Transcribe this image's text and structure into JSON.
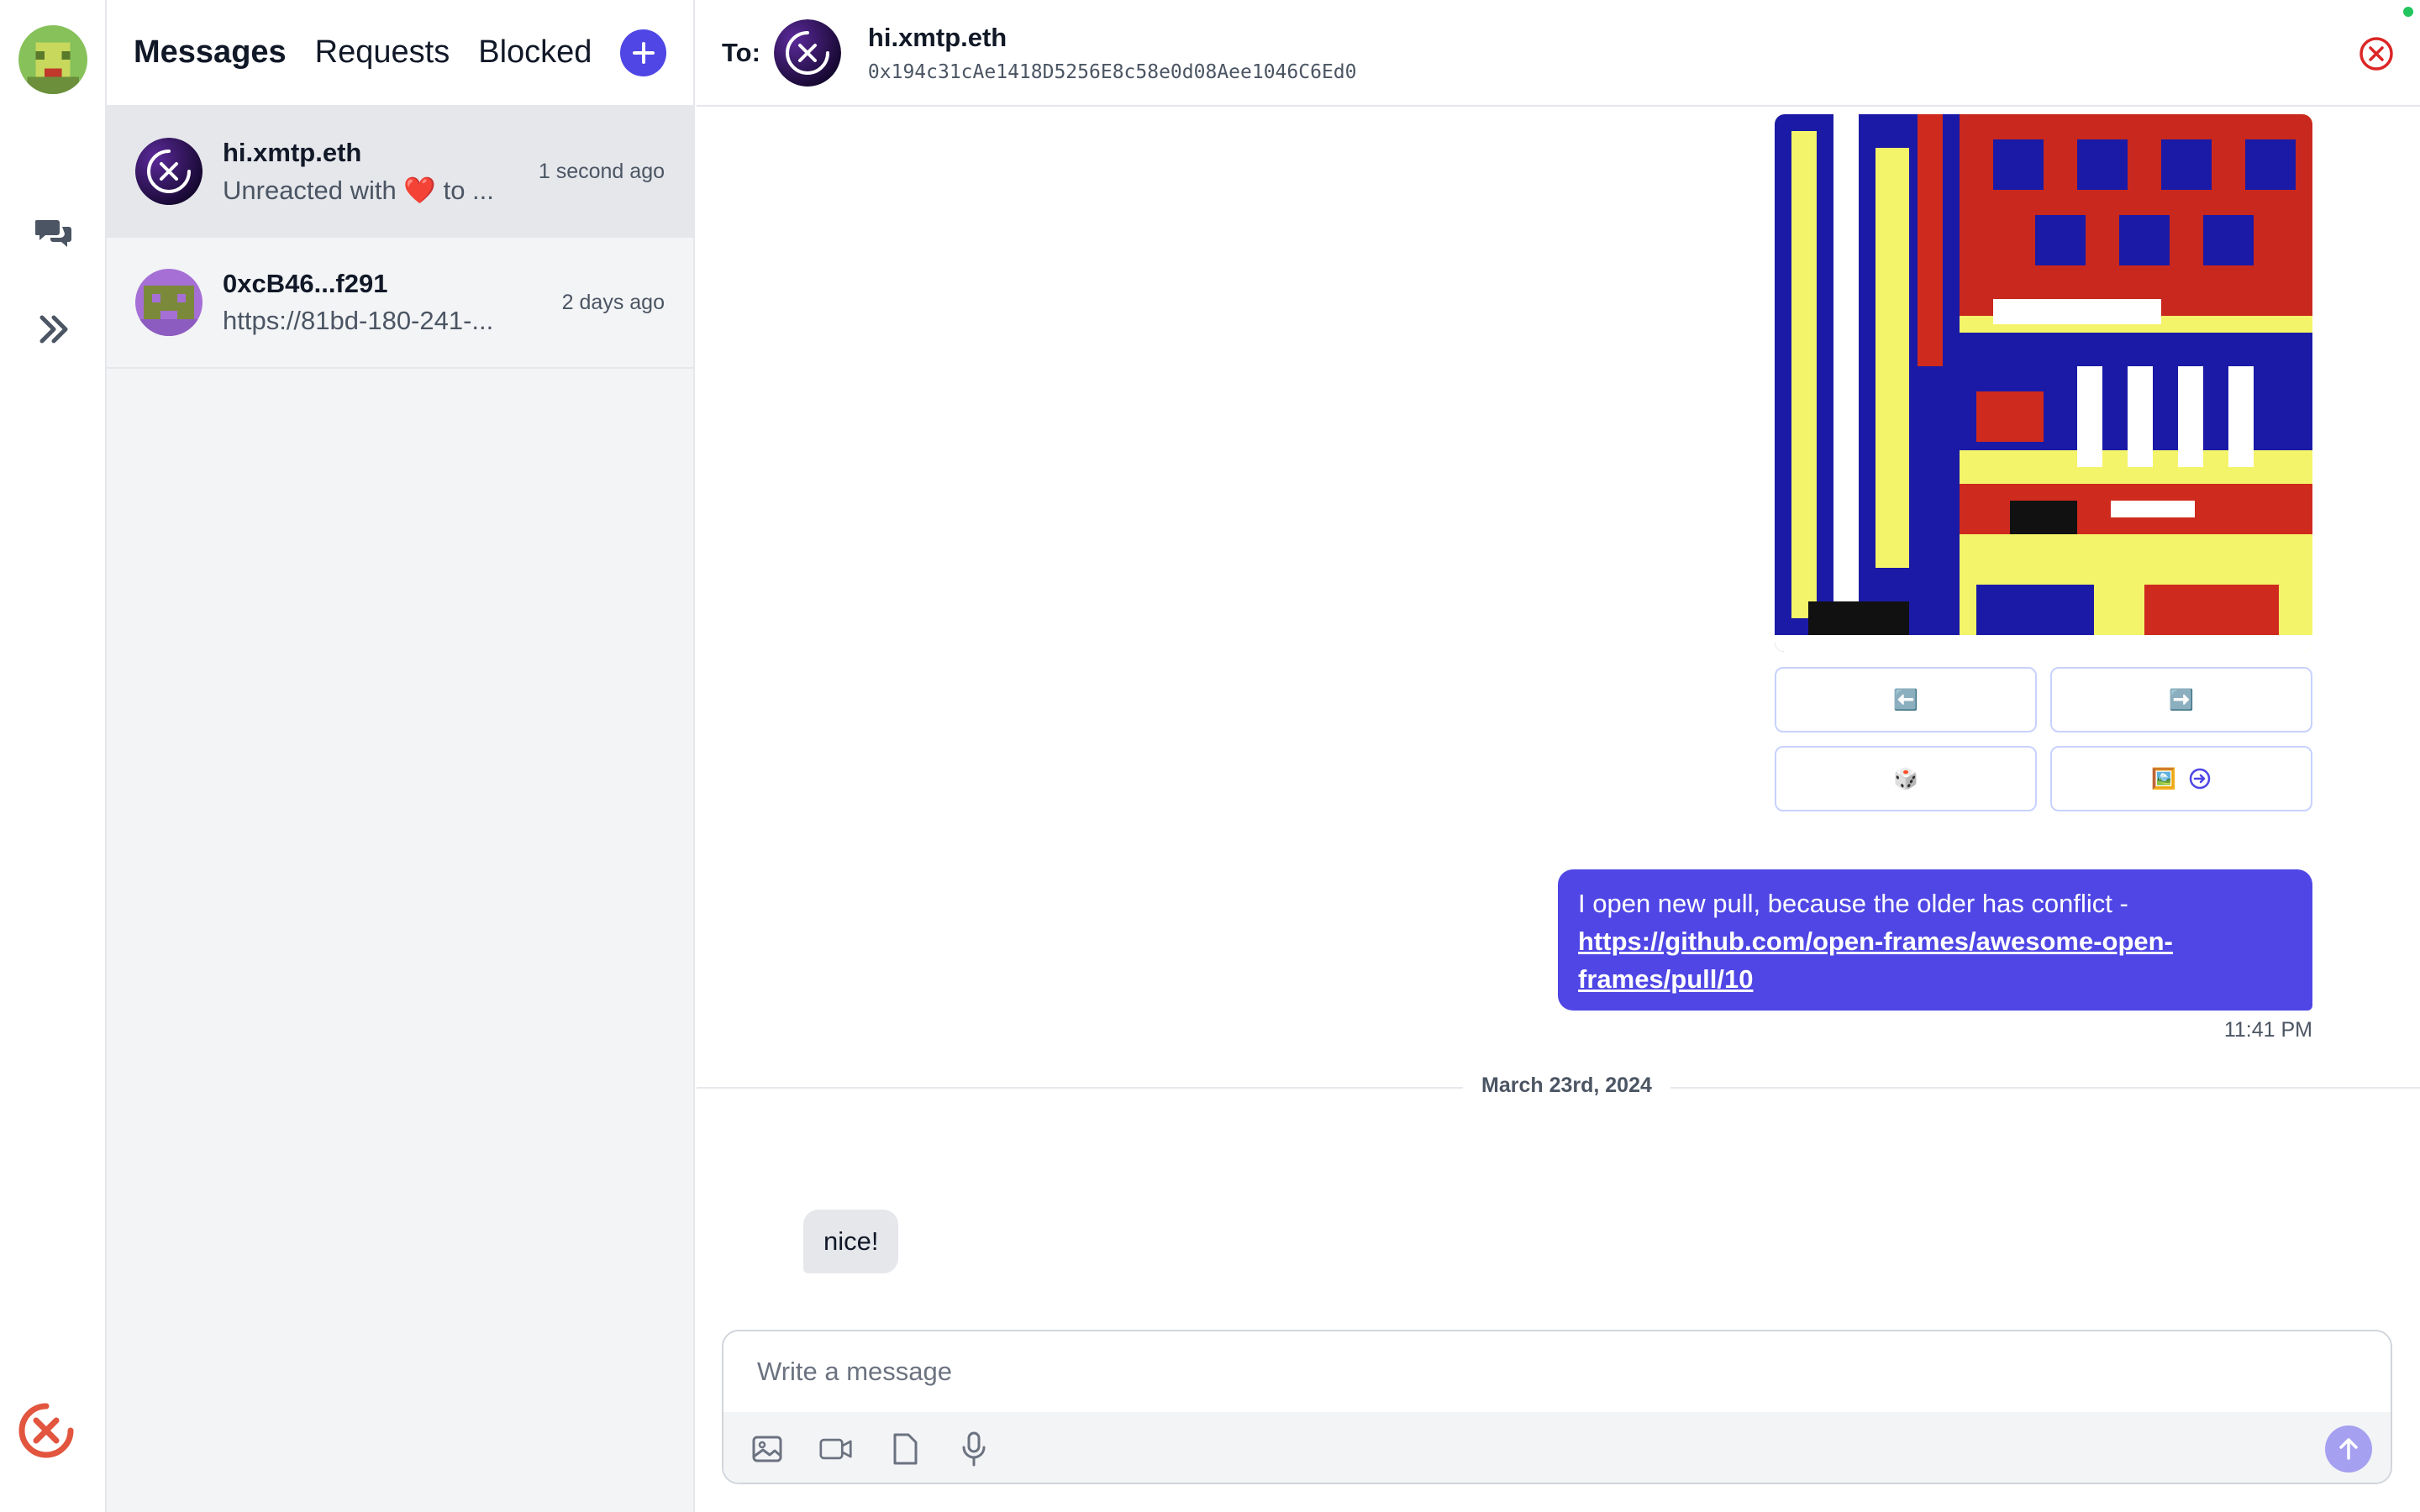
{
  "rail": {
    "avatar_icon": "pixel-avatar-icon",
    "nav": [
      {
        "icon": "chat-bubbles-icon"
      },
      {
        "icon": "double-chevron-right-icon"
      }
    ],
    "logo_icon": "xmtp-logo-icon"
  },
  "list": {
    "tabs": [
      {
        "label": "Messages",
        "active": true
      },
      {
        "label": "Requests",
        "active": false
      },
      {
        "label": "Blocked",
        "active": false
      }
    ],
    "conversations": [
      {
        "name": "hi.xmtp.eth",
        "preview": "Unreacted with ❤️ to ...",
        "time": "1 second ago",
        "selected": true
      },
      {
        "name": "0xcB46...f291",
        "preview": "https://81bd-180-241-...",
        "time": "2 days ago",
        "selected": false
      }
    ]
  },
  "chat": {
    "to_label": "To:",
    "name": "hi.xmtp.eth",
    "address": "0x194c31cAe1418D5256E8c58e0d08Aee1046C6Ed0",
    "frame": {
      "buttons": [
        {
          "label": "⬅️"
        },
        {
          "label": "➡️"
        },
        {
          "label": "🎲"
        },
        {
          "label": "🖼️"
        }
      ]
    },
    "outgoing": {
      "text": "I open new pull, because the older has conflict - ",
      "link": "https://github.com/open-frames/awesome-open-frames/pull/10",
      "time": "11:41 PM"
    },
    "date_separator": "March 23rd, 2024",
    "incoming": {
      "text": "nice!"
    },
    "composer": {
      "placeholder": "Write a message",
      "tools": [
        "image-icon",
        "video-icon",
        "file-icon",
        "microphone-icon"
      ]
    }
  },
  "colors": {
    "accent": "#4f46e5",
    "close": "#dc2626",
    "online": "#22c55e"
  }
}
